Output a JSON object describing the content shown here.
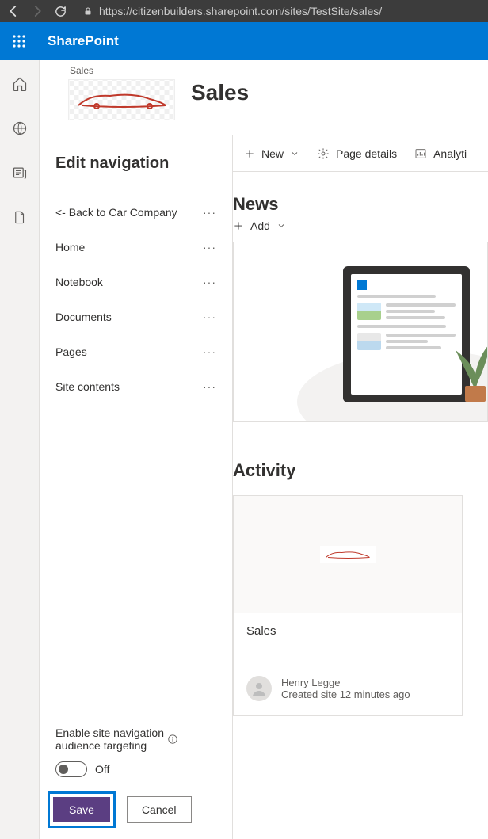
{
  "browser": {
    "url": "https://citizenbuilders.sharepoint.com/sites/TestSite/sales/"
  },
  "suite": {
    "brand": "SharePoint"
  },
  "site": {
    "breadcrumb": "Sales",
    "title": "Sales"
  },
  "editnav": {
    "heading": "Edit navigation",
    "items": [
      {
        "label": "<- Back to Car Company"
      },
      {
        "label": "Home"
      },
      {
        "label": "Notebook"
      },
      {
        "label": "Documents"
      },
      {
        "label": "Pages"
      },
      {
        "label": "Site contents"
      }
    ],
    "audience_targeting_label_line1": "Enable site navigation",
    "audience_targeting_label_line2": "audience targeting",
    "toggle_state": "Off",
    "save_label": "Save",
    "cancel_label": "Cancel"
  },
  "commandbar": {
    "new_label": "New",
    "page_details_label": "Page details",
    "analytics_label": "Analyti"
  },
  "news": {
    "heading": "News",
    "add_label": "Add"
  },
  "activity": {
    "heading": "Activity",
    "card": {
      "title": "Sales",
      "author": "Henry Legge",
      "time": "Created site 12 minutes ago"
    }
  }
}
